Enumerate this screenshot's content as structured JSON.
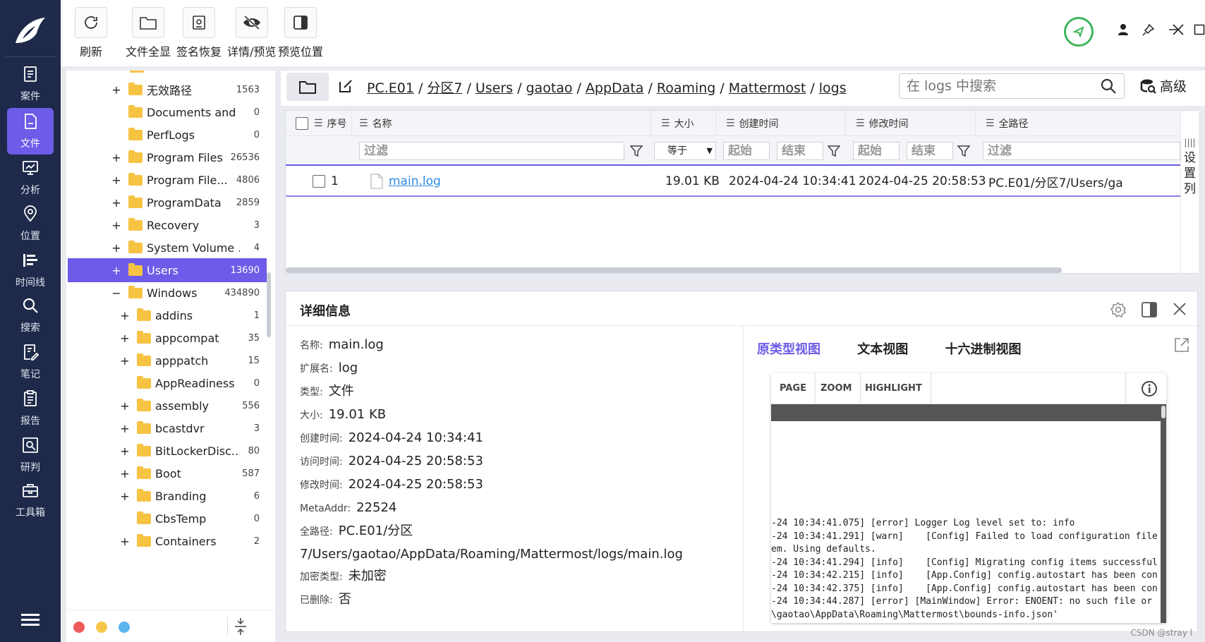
{
  "nav": {
    "items": [
      {
        "label": "案件",
        "icon": "case-icon"
      },
      {
        "label": "文件",
        "icon": "file-icon",
        "active": true
      },
      {
        "label": "分析",
        "icon": "analysis-icon"
      },
      {
        "label": "位置",
        "icon": "location-icon"
      },
      {
        "label": "时间线",
        "icon": "timeline-icon"
      },
      {
        "label": "搜索",
        "icon": "search-icon"
      },
      {
        "label": "笔记",
        "icon": "notes-icon"
      },
      {
        "label": "报告",
        "icon": "report-icon"
      },
      {
        "label": "研判",
        "icon": "investigate-icon"
      },
      {
        "label": "工具箱",
        "icon": "toolbox-icon"
      }
    ]
  },
  "toolbar": {
    "refresh": "刷新",
    "show_all": "文件全显",
    "signature_restore": "签名恢复",
    "detail_preview": "详情/预览",
    "preview_position": "预览位置"
  },
  "tree": {
    "rows": [
      {
        "name": "无效路径",
        "count": "1563",
        "expander": "+"
      },
      {
        "name": "Documents and ...",
        "count": "0",
        "expander": ""
      },
      {
        "name": "PerfLogs",
        "count": "0",
        "expander": ""
      },
      {
        "name": "Program Files",
        "count": "26536",
        "expander": "+"
      },
      {
        "name": "Program File...",
        "count": "4806",
        "expander": "+"
      },
      {
        "name": "ProgramData",
        "count": "2859",
        "expander": "+"
      },
      {
        "name": "Recovery",
        "count": "3",
        "expander": "+"
      },
      {
        "name": "System Volume ...",
        "count": "4",
        "expander": "+"
      },
      {
        "name": "Users",
        "count": "13690",
        "expander": "+",
        "selected": true
      },
      {
        "name": "Windows",
        "count": "434890",
        "expander": "−"
      },
      {
        "name": "addins",
        "count": "1",
        "expander": "+",
        "child": true
      },
      {
        "name": "appcompat",
        "count": "35",
        "expander": "+",
        "child": true
      },
      {
        "name": "apppatch",
        "count": "15",
        "expander": "+",
        "child": true
      },
      {
        "name": "AppReadiness",
        "count": "0",
        "expander": "",
        "child": true
      },
      {
        "name": "assembly",
        "count": "556",
        "expander": "+",
        "child": true
      },
      {
        "name": "bcastdvr",
        "count": "3",
        "expander": "+",
        "child": true
      },
      {
        "name": "BitLockerDisc...",
        "count": "80",
        "expander": "+",
        "child": true
      },
      {
        "name": "Boot",
        "count": "587",
        "expander": "+",
        "child": true
      },
      {
        "name": "Branding",
        "count": "6",
        "expander": "+",
        "child": true
      },
      {
        "name": "CbsTemp",
        "count": "0",
        "expander": "",
        "child": true
      },
      {
        "name": "Containers",
        "count": "2",
        "expander": "+",
        "child": true
      }
    ]
  },
  "path": {
    "crumbs": [
      "PC.E01",
      "分区7",
      "Users",
      "gaotao",
      "AppData",
      "Roaming",
      "Mattermost",
      "logs"
    ],
    "search_placeholder": "在 logs 中搜索",
    "advanced": "高级"
  },
  "table": {
    "headers": {
      "index": "序号",
      "name": "名称",
      "size": "大小",
      "created": "创建时间",
      "modified": "修改时间",
      "fullpath": "全路径"
    },
    "filters": {
      "name": "过滤",
      "size_op": "等于",
      "created_start": "起始",
      "created_end": "结束",
      "modified_start": "起始",
      "modified_end": "结束",
      "fullpath": "过滤"
    },
    "rows": [
      {
        "index": "1",
        "name": "main.log",
        "size": "19.01 KB",
        "created": "2024-04-24 10:34:41",
        "modified": "2024-04-25 20:58:53",
        "fullpath": "PC.E01/分区7/Users/ga"
      }
    ],
    "settings_label": [
      "设",
      "置",
      "列"
    ]
  },
  "detail": {
    "title": "详细信息",
    "props": [
      {
        "k": "名称:",
        "v": "main.log"
      },
      {
        "k": "扩展名:",
        "v": "log"
      },
      {
        "k": "类型:",
        "v": "文件"
      },
      {
        "k": "大小:",
        "v": "19.01 KB"
      },
      {
        "k": "创建时间:",
        "v": "2024-04-24 10:34:41"
      },
      {
        "k": "访问时间:",
        "v": "2024-04-25 20:58:53"
      },
      {
        "k": "修改时间:",
        "v": "2024-04-25 20:58:53"
      },
      {
        "k": "MetaAddr:",
        "v": "22524"
      },
      {
        "k": "全路径:",
        "v": "PC.E01/分区7/Users/gaotao/AppData/Roaming/Mattermost/logs/main.log"
      },
      {
        "k": "加密类型:",
        "v": "未加密"
      },
      {
        "k": "已删除:",
        "v": "否"
      }
    ],
    "tabs": [
      "原类型视图",
      "文本视图",
      "十六进制视图"
    ],
    "viewer": {
      "page": "PAGE",
      "zoom": "ZOOM",
      "highlight": "HIGHLIGHT",
      "log_lines": [
        "-24 10:34:41.075] [error] Logger Log level set to: info",
        "-24 10:34:41.291] [warn]    [Config] Failed to load configuration file",
        "em. Using defaults.",
        "-24 10:34:41.294] [info]    [Config] Migrating config items successful",
        "-24 10:34:42.215] [info]    [App.Config] config.autostart has been con",
        "-24 10:34:42.375] [info]    [App.Config] config.autostart has been con",
        "-24 10:34:44.287] [error] [MainWindow] Error: ENOENT: no such file or",
        "\\gaotao\\AppData\\Roaming\\Mattermost\\bounds-info.json'"
      ]
    }
  },
  "watermark": "CSDN @stray l",
  "colors": {
    "accent": "#6c5ce7",
    "nav_bg": "#1f2a4a",
    "folder": "#f6c343",
    "link": "#2d8ae6",
    "status_green": "#3fb55b"
  }
}
